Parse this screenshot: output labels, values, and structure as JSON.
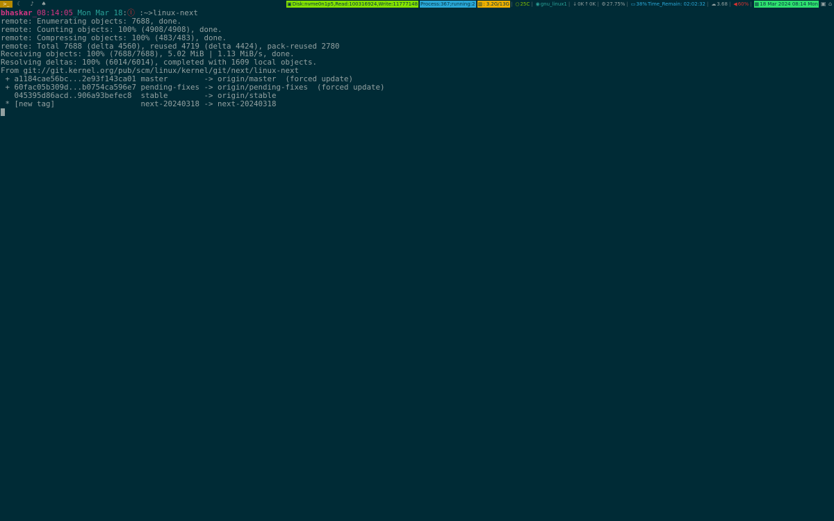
{
  "topbar": {
    "workspace_active": ">_",
    "workspace_icons": [
      "moon-icon",
      "note-icon",
      "flame-icon"
    ],
    "status": {
      "disk": "Disk:nvme0n1p5,Read:100316924,Write:11777148",
      "process": "Process:367;running:2",
      "memory": ": 3.2G/13G",
      "temp": "25C",
      "wifi": "gnu_linux1",
      "down": "0K",
      "up": "0K",
      "cpu": "27.75%",
      "battery": "38%",
      "time_remain": "Time_Remain: 02:02:32",
      "load": "3.68",
      "volume": "60%",
      "datetime": "18 Mar 2024 08:14 Mon"
    },
    "colors": {
      "disk": "#85e300",
      "process": "#2aa8d8",
      "memory": "#f0b000",
      "date": "#2ee06e",
      "workspace": "#b58900"
    }
  },
  "terminal": {
    "prompt": {
      "user": "bhaskar",
      "time": "_08:14:05",
      "date": "_Mon Mar 18",
      "colon": ":",
      "git_symbol": "ⓛ",
      "cwd": " :~>",
      "command": "linux-next"
    },
    "output": [
      "remote: Enumerating objects: 7688, done.",
      "remote: Counting objects: 100% (4908/4908), done.",
      "remote: Compressing objects: 100% (483/483), done.",
      "remote: Total 7688 (delta 4560), reused 4719 (delta 4424), pack-reused 2780",
      "Receiving objects: 100% (7688/7688), 5.02 MiB | 1.13 MiB/s, done.",
      "Resolving deltas: 100% (6014/6014), completed with 1609 local objects.",
      "From git://git.kernel.org/pub/scm/linux/kernel/git/next/linux-next",
      " + a1184cae56bc...2e93f143ca01 master        -> origin/master  (forced update)",
      " + 60fac05b309d...b0754ca596e7 pending-fixes -> origin/pending-fixes  (forced update)",
      "   045395d86acd..906a93befec8  stable        -> origin/stable",
      " * [new tag]                   next-20240318 -> next-20240318"
    ]
  }
}
